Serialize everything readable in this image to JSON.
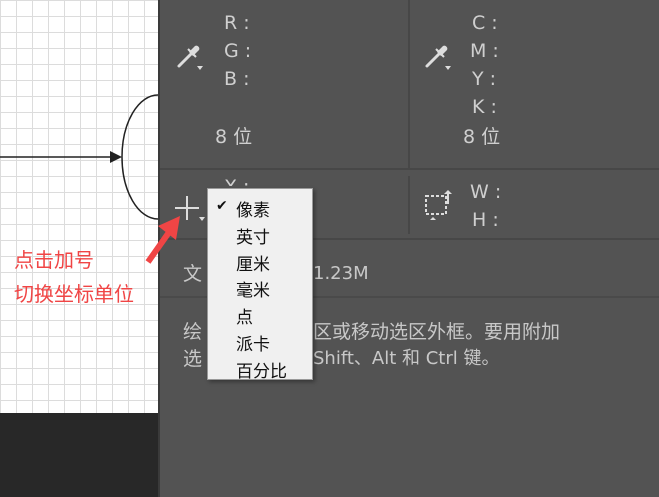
{
  "info_panel": {
    "rgb": {
      "labels": [
        "R :",
        "G :",
        "B :"
      ],
      "bit_depth": "8 位"
    },
    "cmyk": {
      "labels": [
        "C :",
        "M :",
        "Y :",
        "K :"
      ],
      "bit_depth": "8 位"
    },
    "xy": {
      "x_label": "X :"
    },
    "wh": {
      "w_label": "W :",
      "h_label": "H :"
    },
    "doc": {
      "prefix": "文",
      "value": "1.23M"
    },
    "hint": {
      "line1_a": "绘",
      "line1_b": "区或移动选区外框。要用附加",
      "line2_a": "选",
      "line2_b": "Shift、Alt 和 Ctrl 键。"
    }
  },
  "unit_menu": {
    "selected": "像素",
    "items": [
      "像素",
      "英寸",
      "厘米",
      "毫米",
      "点",
      "派卡",
      "百分比"
    ]
  },
  "annotation": {
    "line1": "点击加号",
    "line2": "切换坐标单位"
  },
  "colors": {
    "panel_bg": "#535353",
    "text": "#cfcfcf",
    "annotation": "#f04545",
    "menu_bg": "#f0f0f0"
  },
  "icons": {
    "eyedropper": "eyedropper-icon",
    "crosshair": "crosshair-plus-icon",
    "selection": "selection-size-icon"
  }
}
